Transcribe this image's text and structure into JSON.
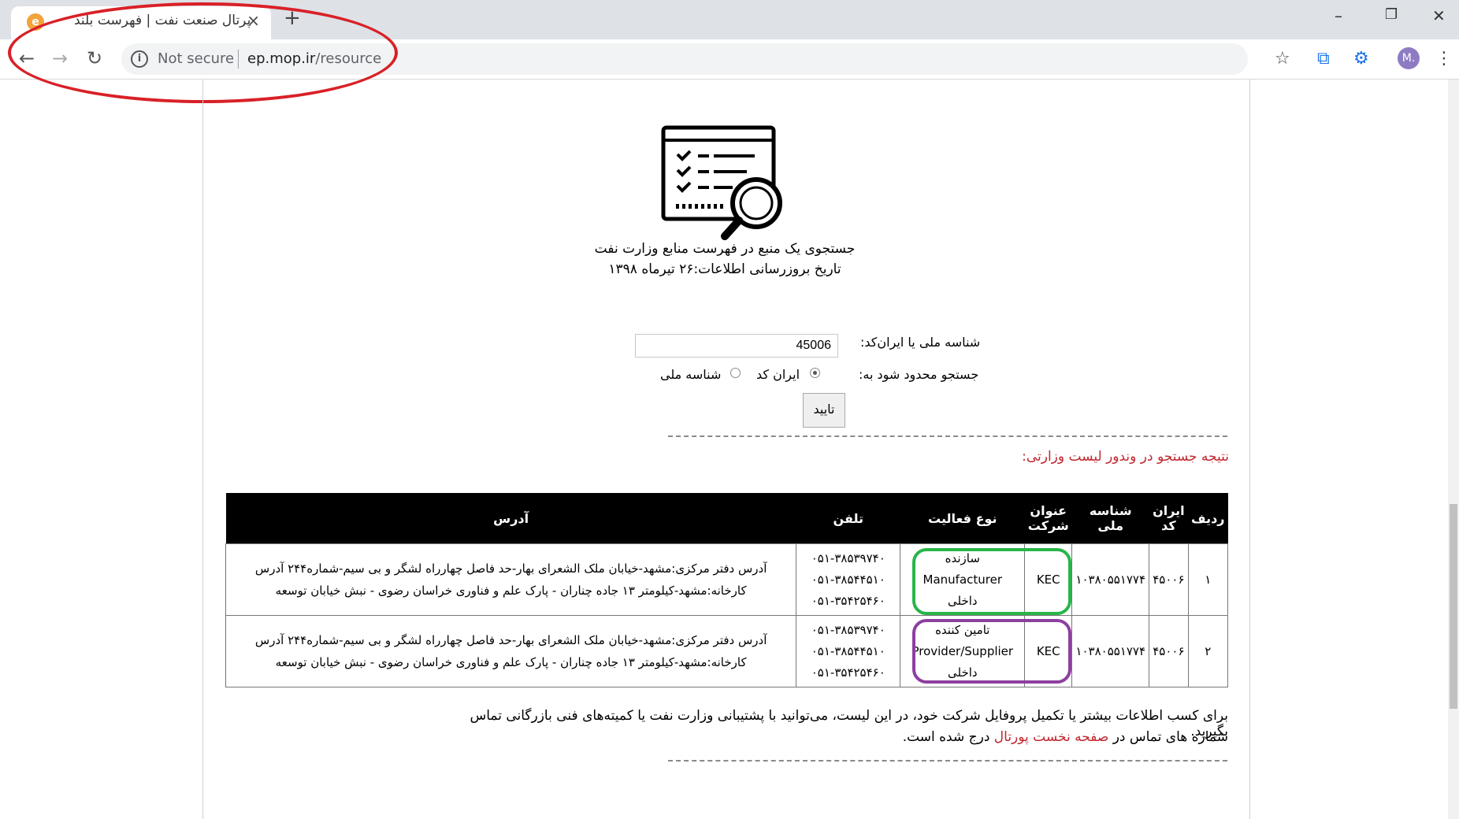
{
  "browser": {
    "tab_title": "پرتال صنعت نفت | فهرست بلند",
    "tab_close": "×",
    "new_tab": "+",
    "security_label": "Not secure",
    "url_host": "ep.mop.ir",
    "url_path": "/resource",
    "avatar": "M."
  },
  "page": {
    "heading": "جستجوی یک منبع در فهرست منابع وزارت نفت",
    "update_date": "تاریخ بروزرسانی اطلاعات:۲۶ تیرماه ۱۳۹۸",
    "search": {
      "label": "شناسه ملی یا ایران‌کد:",
      "value": "45006",
      "limit_label": "جستجو محدود شود به:",
      "option_iran_code": "ایران کد",
      "option_national_id": "شناسه ملی",
      "selected": "ایران کد",
      "submit": "تایید"
    },
    "result_title": "نتیجه جستجو در وندور لیست وزارتی:",
    "table": {
      "headers": {
        "row": "ردیف",
        "iran_code": "ایران کد",
        "national_id": "شناسه ملی",
        "company": "عنوان شرکت",
        "activity": "نوع فعالیت",
        "phone": "تلفن",
        "address": "آدرس"
      },
      "rows": [
        {
          "row": "۱",
          "iran_code": "۴۵۰۰۶",
          "national_id": "۱۰۳۸۰۵۵۱۷۷۴",
          "company": "KEC",
          "activity_fa": "سازنده",
          "activity_en": "Manufacturer",
          "activity_scope": "داخلی",
          "phone_1": "۰۵۱-۳۸۵۳۹۷۴۰",
          "phone_2": "۰۵۱-۳۸۵۴۴۵۱۰",
          "phone_3": "۰۵۱-۳۵۴۲۵۴۶۰",
          "address_1": "آدرس دفتر مرکزی:مشهد-خیابان ملک الشعرای بهار-حد فاصل چهارراه لشگر و بی سیم-شماره۲۴۴ آدرس",
          "address_2": "کارخانه:مشهد-کیلومتر ۱۳ جاده چناران - پارک علم و فناوری خراسان رضوی - نبش خیابان توسعه"
        },
        {
          "row": "۲",
          "iran_code": "۴۵۰۰۶",
          "national_id": "۱۰۳۸۰۵۵۱۷۷۴",
          "company": "KEC",
          "activity_fa": "تامین کننده",
          "activity_en": "Provider/Supplier",
          "activity_scope": "داخلی",
          "phone_1": "۰۵۱-۳۸۵۳۹۷۴۰",
          "phone_2": "۰۵۱-۳۸۵۴۴۵۱۰",
          "phone_3": "۰۵۱-۳۵۴۲۵۴۶۰",
          "address_1": "آدرس دفتر مرکزی:مشهد-خیابان ملک الشعرای بهار-حد فاصل چهارراه لشگر و بی سیم-شماره۲۴۴ آدرس",
          "address_2": "کارخانه:مشهد-کیلومتر ۱۳ جاده چناران - پارک علم و فناوری خراسان رضوی - نبش خیابان توسعه"
        }
      ]
    },
    "footer": {
      "line1": "برای کسب اطلاعات بیشتر یا تکمیل پروفایل شرکت خود، در این لیست، می‌توانید با پشتیبانی وزارت نفت یا کمیته‌های فنی بازرگانی تماس بگیرید.",
      "line2_prefix": "شماره های تماس در",
      "line2_link": "صفحه نخست پورتال",
      "line2_suffix": "درج شده است."
    }
  },
  "annotations": {
    "address_bar_color": "#d92027",
    "manufacturer_color": "#29b54a",
    "supplier_color": "#8e3fa0"
  },
  "icons": [
    "back-arrow-icon",
    "forward-arrow-icon",
    "reload-icon",
    "info-icon",
    "star-icon",
    "translate-icon",
    "extension-icon",
    "menu-dots-icon",
    "checklist-search-icon"
  ]
}
